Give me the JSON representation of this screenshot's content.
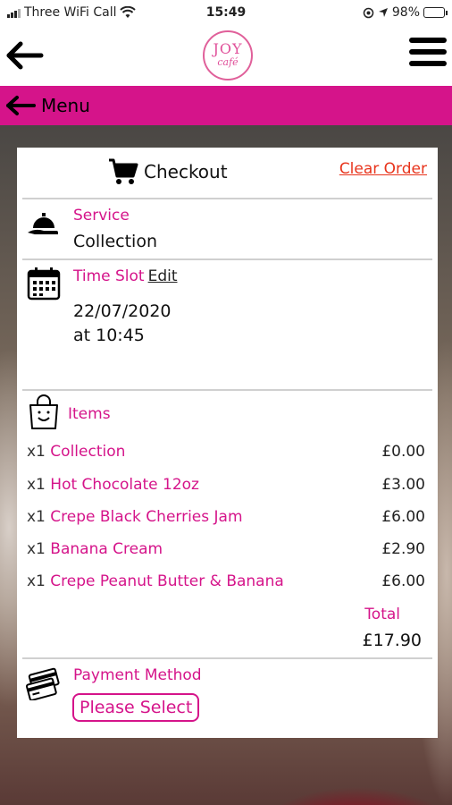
{
  "status_bar": {
    "carrier": "Three WiFi Call",
    "time": "15:49",
    "battery": "98%"
  },
  "header": {
    "logo_line1": "JOY",
    "logo_line2": "café"
  },
  "menu_bar": {
    "label": "Menu"
  },
  "checkout": {
    "title": "Checkout",
    "clear_order": "Clear Order",
    "service": {
      "label": "Service",
      "value": "Collection"
    },
    "time_slot": {
      "label": "Time Slot",
      "edit": "Edit",
      "date": "22/07/2020",
      "time": "at 10:45"
    },
    "items": {
      "label": "Items",
      "list": [
        {
          "qty": "x1",
          "name": "Collection",
          "price": "£0.00"
        },
        {
          "qty": "x1",
          "name": "Hot Chocolate 12oz",
          "price": "£3.00"
        },
        {
          "qty": "x1",
          "name": "Crepe Black Cherries Jam",
          "price": "£6.00"
        },
        {
          "qty": "x1",
          "name": "Banana Cream",
          "price": "£2.90"
        },
        {
          "qty": "x1",
          "name": "Crepe Peanut Butter & Banana",
          "price": "£6.00"
        }
      ],
      "total_label": "Total",
      "total_value": "£17.90"
    },
    "payment": {
      "label": "Payment Method",
      "select": "Please Select"
    }
  },
  "colors": {
    "accent": "#d5148a",
    "clear_order": "#e8341c"
  }
}
